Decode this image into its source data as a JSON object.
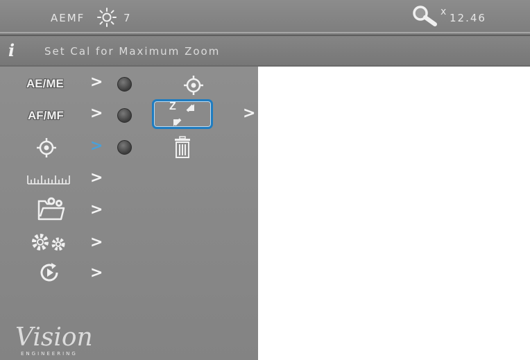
{
  "header": {
    "mode_label": "AEMF",
    "brightness_icon": "sun-icon",
    "brightness_value": "7",
    "zoom_icon": "magnifier-icon",
    "zoom_prefix": "x",
    "zoom_value": "12.46"
  },
  "info_bar": {
    "icon": "info-icon",
    "text": "Set Cal for Maximum Zoom"
  },
  "menu": {
    "items": [
      {
        "label": "AE/ME",
        "icon": "",
        "chevron": ">",
        "active": false
      },
      {
        "label": "AF/MF",
        "icon": "",
        "chevron": ">",
        "active": false
      },
      {
        "label": "",
        "icon": "crosshair-target-icon",
        "chevron": ">",
        "active": true
      },
      {
        "label": "",
        "icon": "ruler-icon",
        "chevron": ">",
        "active": false
      },
      {
        "label": "",
        "icon": "folder-settings-icon",
        "chevron": ">",
        "active": false
      },
      {
        "label": "",
        "icon": "gears-icon",
        "chevron": ">",
        "active": false
      },
      {
        "label": "",
        "icon": "play-refresh-icon",
        "chevron": ">",
        "active": false
      }
    ]
  },
  "submenu": {
    "items": [
      {
        "icon": "crosshair-target-icon"
      },
      {
        "icon": "zoom-calibrate-icon",
        "label": "Z",
        "selected": true,
        "chevron": ">"
      },
      {
        "icon": "trash-icon"
      }
    ]
  },
  "logo": {
    "text": "Vision",
    "subtext": "ENGINEERING"
  },
  "colors": {
    "panel": "#8a8a8a",
    "accent": "#1f7cc0",
    "chevron_active": "#4aa0d8"
  }
}
